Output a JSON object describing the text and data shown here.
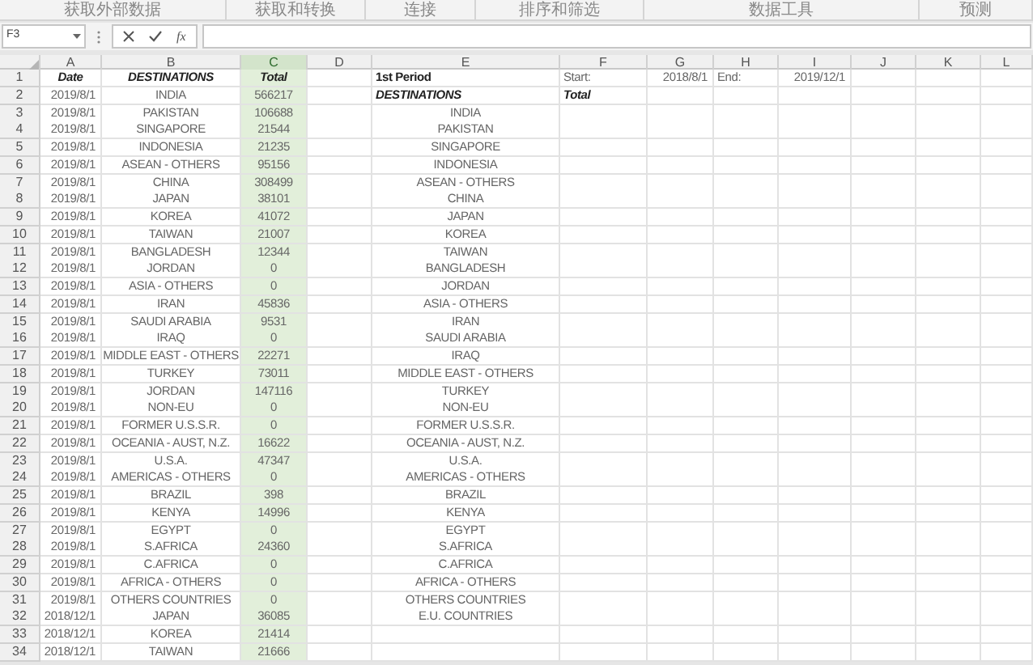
{
  "ribbon_groups": [
    "获取外部数据",
    "获取和转换",
    "连接",
    "排序和筛选",
    "数据工具",
    "预测"
  ],
  "formula_bar": {
    "name_box": "F3",
    "function_label": "fx"
  },
  "columns": [
    {
      "letter": "A",
      "selected": false
    },
    {
      "letter": "B",
      "selected": false
    },
    {
      "letter": "C",
      "selected": true
    },
    {
      "letter": "D",
      "selected": false
    },
    {
      "letter": "E",
      "selected": false
    },
    {
      "letter": "F",
      "selected": false
    },
    {
      "letter": "G",
      "selected": false
    },
    {
      "letter": "H",
      "selected": false
    },
    {
      "letter": "I",
      "selected": false
    },
    {
      "letter": "J",
      "selected": false
    },
    {
      "letter": "K",
      "selected": false
    },
    {
      "letter": "L",
      "selected": false
    }
  ],
  "rows": [
    {
      "number": "1",
      "column_a": {
        "text": "Date",
        "kind": "header"
      },
      "column_b": {
        "text": "DESTINATIONS",
        "kind": "header"
      },
      "column_c": {
        "text": "Total",
        "kind": "header"
      },
      "column_e": {
        "text": "1st Period",
        "kind": "title"
      },
      "column_f": {
        "text": "Start:",
        "kind": "label"
      },
      "column_g": {
        "text": "2018/8/1",
        "kind": "number"
      },
      "column_h": {
        "text": "End:",
        "kind": "label"
      },
      "column_i": {
        "text": "2019/12/1",
        "kind": "number"
      }
    },
    {
      "number": "2",
      "column_a": {
        "text": "2019/8/1",
        "kind": "number"
      },
      "column_b": {
        "text": "INDIA",
        "kind": "value"
      },
      "column_c": {
        "text": "566217",
        "kind": "value"
      },
      "column_e": {
        "text": "DESTINATIONS",
        "kind": "header_left"
      },
      "column_f": {
        "text": "Total",
        "kind": "header_left"
      }
    },
    {
      "number": "3",
      "column_a": {
        "text": "2019/8/1",
        "kind": "number"
      },
      "column_b": {
        "text": "PAKISTAN",
        "kind": "value"
      },
      "column_c": {
        "text": "106688",
        "kind": "value"
      },
      "column_e": {
        "text": "INDIA",
        "kind": "value"
      }
    },
    {
      "number": "4",
      "column_a": {
        "text": "2019/8/1",
        "kind": "number"
      },
      "column_b": {
        "text": "SINGAPORE",
        "kind": "value"
      },
      "column_c": {
        "text": "21544",
        "kind": "value"
      },
      "column_e": {
        "text": "PAKISTAN",
        "kind": "value"
      }
    },
    {
      "number": "5",
      "column_a": {
        "text": "2019/8/1",
        "kind": "number"
      },
      "column_b": {
        "text": "INDONESIA",
        "kind": "value"
      },
      "column_c": {
        "text": "21235",
        "kind": "value"
      },
      "column_e": {
        "text": "SINGAPORE",
        "kind": "value"
      }
    },
    {
      "number": "6",
      "column_a": {
        "text": "2019/8/1",
        "kind": "number"
      },
      "column_b": {
        "text": "ASEAN - OTHERS",
        "kind": "value"
      },
      "column_c": {
        "text": "95156",
        "kind": "value"
      },
      "column_e": {
        "text": "INDONESIA",
        "kind": "value"
      }
    },
    {
      "number": "7",
      "column_a": {
        "text": "2019/8/1",
        "kind": "number"
      },
      "column_b": {
        "text": "CHINA",
        "kind": "value"
      },
      "column_c": {
        "text": "308499",
        "kind": "value"
      },
      "column_e": {
        "text": "ASEAN - OTHERS",
        "kind": "value"
      }
    },
    {
      "number": "8",
      "column_a": {
        "text": "2019/8/1",
        "kind": "number"
      },
      "column_b": {
        "text": "JAPAN",
        "kind": "value"
      },
      "column_c": {
        "text": "38101",
        "kind": "value"
      },
      "column_e": {
        "text": "CHINA",
        "kind": "value"
      }
    },
    {
      "number": "9",
      "column_a": {
        "text": "2019/8/1",
        "kind": "number"
      },
      "column_b": {
        "text": "KOREA",
        "kind": "value"
      },
      "column_c": {
        "text": "41072",
        "kind": "value"
      },
      "column_e": {
        "text": "JAPAN",
        "kind": "value"
      }
    },
    {
      "number": "10",
      "column_a": {
        "text": "2019/8/1",
        "kind": "number"
      },
      "column_b": {
        "text": "TAIWAN",
        "kind": "value"
      },
      "column_c": {
        "text": "21007",
        "kind": "value"
      },
      "column_e": {
        "text": "KOREA",
        "kind": "value"
      }
    },
    {
      "number": "11",
      "column_a": {
        "text": "2019/8/1",
        "kind": "number"
      },
      "column_b": {
        "text": "BANGLADESH",
        "kind": "value"
      },
      "column_c": {
        "text": "12344",
        "kind": "value"
      },
      "column_e": {
        "text": "TAIWAN",
        "kind": "value"
      }
    },
    {
      "number": "12",
      "column_a": {
        "text": "2019/8/1",
        "kind": "number"
      },
      "column_b": {
        "text": "JORDAN",
        "kind": "value"
      },
      "column_c": {
        "text": "0",
        "kind": "value"
      },
      "column_e": {
        "text": "BANGLADESH",
        "kind": "value"
      }
    },
    {
      "number": "13",
      "column_a": {
        "text": "2019/8/1",
        "kind": "number"
      },
      "column_b": {
        "text": "ASIA - OTHERS",
        "kind": "value"
      },
      "column_c": {
        "text": "0",
        "kind": "value"
      },
      "column_e": {
        "text": "JORDAN",
        "kind": "value"
      }
    },
    {
      "number": "14",
      "column_a": {
        "text": "2019/8/1",
        "kind": "number"
      },
      "column_b": {
        "text": "IRAN",
        "kind": "value"
      },
      "column_c": {
        "text": "45836",
        "kind": "value"
      },
      "column_e": {
        "text": "ASIA - OTHERS",
        "kind": "value"
      }
    },
    {
      "number": "15",
      "column_a": {
        "text": "2019/8/1",
        "kind": "number"
      },
      "column_b": {
        "text": "SAUDI ARABIA",
        "kind": "value"
      },
      "column_c": {
        "text": "9531",
        "kind": "value"
      },
      "column_e": {
        "text": "IRAN",
        "kind": "value"
      }
    },
    {
      "number": "16",
      "column_a": {
        "text": "2019/8/1",
        "kind": "number"
      },
      "column_b": {
        "text": "IRAQ",
        "kind": "value"
      },
      "column_c": {
        "text": "0",
        "kind": "value"
      },
      "column_e": {
        "text": "SAUDI ARABIA",
        "kind": "value"
      }
    },
    {
      "number": "17",
      "column_a": {
        "text": "2019/8/1",
        "kind": "number"
      },
      "column_b": {
        "text": "MIDDLE EAST - OTHERS",
        "kind": "value"
      },
      "column_c": {
        "text": "22271",
        "kind": "value"
      },
      "column_e": {
        "text": "IRAQ",
        "kind": "value"
      }
    },
    {
      "number": "18",
      "column_a": {
        "text": "2019/8/1",
        "kind": "number"
      },
      "column_b": {
        "text": "TURKEY",
        "kind": "value"
      },
      "column_c": {
        "text": "73011",
        "kind": "value"
      },
      "column_e": {
        "text": "MIDDLE EAST - OTHERS",
        "kind": "value"
      }
    },
    {
      "number": "19",
      "column_a": {
        "text": "2019/8/1",
        "kind": "number"
      },
      "column_b": {
        "text": "JORDAN",
        "kind": "value"
      },
      "column_c": {
        "text": "147116",
        "kind": "value"
      },
      "column_e": {
        "text": "TURKEY",
        "kind": "value"
      }
    },
    {
      "number": "20",
      "column_a": {
        "text": "2019/8/1",
        "kind": "number"
      },
      "column_b": {
        "text": "NON-EU",
        "kind": "value"
      },
      "column_c": {
        "text": "0",
        "kind": "value"
      },
      "column_e": {
        "text": "NON-EU",
        "kind": "value"
      }
    },
    {
      "number": "21",
      "column_a": {
        "text": "2019/8/1",
        "kind": "number"
      },
      "column_b": {
        "text": "FORMER U.S.S.R.",
        "kind": "value"
      },
      "column_c": {
        "text": "0",
        "kind": "value"
      },
      "column_e": {
        "text": "FORMER U.S.S.R.",
        "kind": "value"
      }
    },
    {
      "number": "22",
      "column_a": {
        "text": "2019/8/1",
        "kind": "number"
      },
      "column_b": {
        "text": "OCEANIA - AUST, N.Z.",
        "kind": "value"
      },
      "column_c": {
        "text": "16622",
        "kind": "value"
      },
      "column_e": {
        "text": "OCEANIA - AUST, N.Z.",
        "kind": "value"
      }
    },
    {
      "number": "23",
      "column_a": {
        "text": "2019/8/1",
        "kind": "number"
      },
      "column_b": {
        "text": "U.S.A.",
        "kind": "value"
      },
      "column_c": {
        "text": "47347",
        "kind": "value"
      },
      "column_e": {
        "text": "U.S.A.",
        "kind": "value"
      }
    },
    {
      "number": "24",
      "column_a": {
        "text": "2019/8/1",
        "kind": "number"
      },
      "column_b": {
        "text": "AMERICAS - OTHERS",
        "kind": "value"
      },
      "column_c": {
        "text": "0",
        "kind": "value"
      },
      "column_e": {
        "text": "AMERICAS - OTHERS",
        "kind": "value"
      }
    },
    {
      "number": "25",
      "column_a": {
        "text": "2019/8/1",
        "kind": "number"
      },
      "column_b": {
        "text": "BRAZIL",
        "kind": "value"
      },
      "column_c": {
        "text": "398",
        "kind": "value"
      },
      "column_e": {
        "text": "BRAZIL",
        "kind": "value"
      }
    },
    {
      "number": "26",
      "column_a": {
        "text": "2019/8/1",
        "kind": "number"
      },
      "column_b": {
        "text": "KENYA",
        "kind": "value"
      },
      "column_c": {
        "text": "14996",
        "kind": "value"
      },
      "column_e": {
        "text": "KENYA",
        "kind": "value"
      }
    },
    {
      "number": "27",
      "column_a": {
        "text": "2019/8/1",
        "kind": "number"
      },
      "column_b": {
        "text": "EGYPT",
        "kind": "value"
      },
      "column_c": {
        "text": "0",
        "kind": "value"
      },
      "column_e": {
        "text": "EGYPT",
        "kind": "value"
      }
    },
    {
      "number": "28",
      "column_a": {
        "text": "2019/8/1",
        "kind": "number"
      },
      "column_b": {
        "text": "S.AFRICA",
        "kind": "value"
      },
      "column_c": {
        "text": "24360",
        "kind": "value"
      },
      "column_e": {
        "text": "S.AFRICA",
        "kind": "value"
      }
    },
    {
      "number": "29",
      "column_a": {
        "text": "2019/8/1",
        "kind": "number"
      },
      "column_b": {
        "text": "C.AFRICA",
        "kind": "value"
      },
      "column_c": {
        "text": "0",
        "kind": "value"
      },
      "column_e": {
        "text": "C.AFRICA",
        "kind": "value"
      }
    },
    {
      "number": "30",
      "column_a": {
        "text": "2019/8/1",
        "kind": "number"
      },
      "column_b": {
        "text": "AFRICA - OTHERS",
        "kind": "value"
      },
      "column_c": {
        "text": "0",
        "kind": "value"
      },
      "column_e": {
        "text": "AFRICA - OTHERS",
        "kind": "value"
      }
    },
    {
      "number": "31",
      "column_a": {
        "text": "2019/8/1",
        "kind": "number"
      },
      "column_b": {
        "text": "OTHERS COUNTRIES",
        "kind": "value"
      },
      "column_c": {
        "text": "0",
        "kind": "value"
      },
      "column_e": {
        "text": "OTHERS COUNTRIES",
        "kind": "value"
      }
    },
    {
      "number": "32",
      "column_a": {
        "text": "2018/12/1",
        "kind": "number"
      },
      "column_b": {
        "text": "JAPAN",
        "kind": "value"
      },
      "column_c": {
        "text": "36085",
        "kind": "value"
      },
      "column_e": {
        "text": "E.U. COUNTRIES",
        "kind": "value"
      }
    },
    {
      "number": "33",
      "column_a": {
        "text": "2018/12/1",
        "kind": "number"
      },
      "column_b": {
        "text": "KOREA",
        "kind": "value"
      },
      "column_c": {
        "text": "21414",
        "kind": "value"
      }
    },
    {
      "number": "34",
      "column_a": {
        "text": "2018/12/1",
        "kind": "number"
      },
      "column_b": {
        "text": "TAIWAN",
        "kind": "value"
      },
      "column_c": {
        "text": "21666",
        "kind": "value"
      }
    }
  ]
}
